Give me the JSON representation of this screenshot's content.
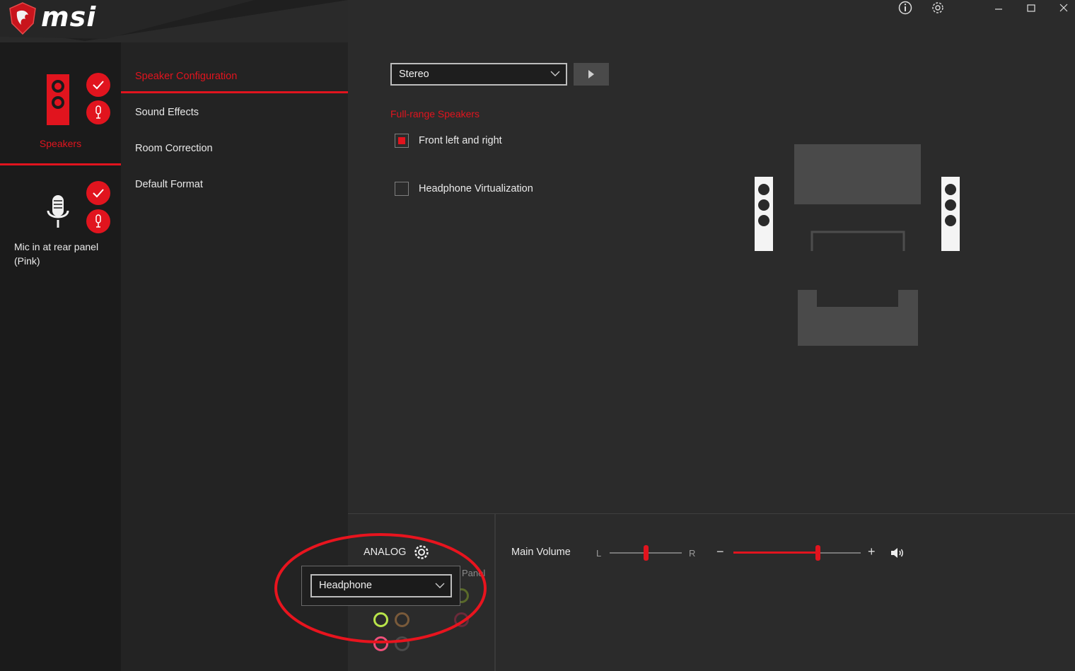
{
  "brand": {
    "logo_text": "msi"
  },
  "devices": [
    {
      "label": "Speakers",
      "active": true
    },
    {
      "label": "Mic in at rear panel\n(Pink)",
      "active": false
    }
  ],
  "menu": {
    "items": [
      {
        "label": "Speaker Configuration",
        "active": true
      },
      {
        "label": "Sound Effects",
        "active": false
      },
      {
        "label": "Room Correction",
        "active": false
      },
      {
        "label": "Default Format",
        "active": false
      }
    ]
  },
  "window_controls": {
    "icons": [
      "info-icon",
      "gear-icon",
      "minimize-icon",
      "maximize-icon",
      "close-icon"
    ]
  },
  "config": {
    "mode_value": "Stereo",
    "section_label": "Full-range Speakers",
    "checkboxes": [
      {
        "label": "Front left and right",
        "checked": true
      },
      {
        "label": "Headphone Virtualization",
        "checked": false
      }
    ]
  },
  "bottom": {
    "analog_label": "ANALOG",
    "panel_label": "Panel",
    "jack_select_value": "Headphone",
    "main_volume_label": "Main Volume",
    "balance_left": "L",
    "balance_right": "R",
    "balance_level": 0.5,
    "volume_minus": "−",
    "volume_plus": "+",
    "volume_level": 0.67
  },
  "colors": {
    "accent": "#e1141e",
    "jack_green": "#b9e54a",
    "jack_brown": "#7a5a3a",
    "jack_pink": "#f0507a",
    "jack_gray": "#4a4a4a"
  }
}
